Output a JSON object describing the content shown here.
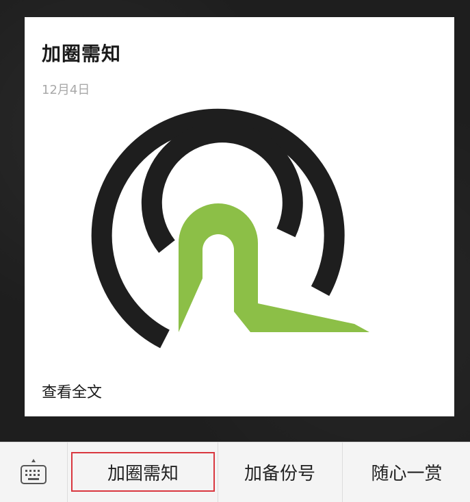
{
  "card": {
    "title": "加圈需知",
    "date": "12月4日",
    "read_more": "查看全文"
  },
  "bottom_bar": {
    "keyboard_icon": "keyboard-icon",
    "menu_items": [
      {
        "label": "加圈需知"
      },
      {
        "label": "加备份号"
      },
      {
        "label": "随心一赏"
      }
    ]
  },
  "colors": {
    "logo_dark": "#1e1e1e",
    "logo_green": "#8cbf47",
    "highlight": "#d9363e"
  }
}
